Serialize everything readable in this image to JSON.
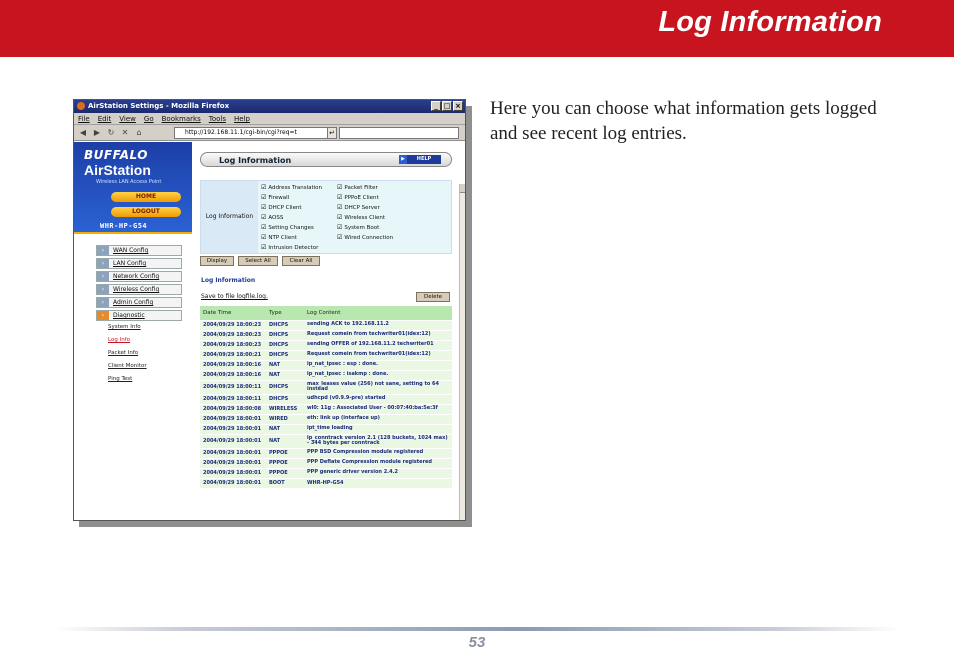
{
  "page": {
    "title": "Log Information",
    "intro": "Here you can choose what information gets logged and see recent log entries.",
    "page_number": "53"
  },
  "browser": {
    "title": "AirStation Settings - Mozilla Firefox",
    "menu": [
      "File",
      "Edit",
      "View",
      "Go",
      "Bookmarks",
      "Tools",
      "Help"
    ],
    "url": "http://192.168.11.1/cgi-bin/cgi?req=t"
  },
  "sidebar": {
    "brand": "BUFFALO",
    "product": "AirStation",
    "product_sub": "Wireless LAN Access Point",
    "home": "HOME",
    "logout": "LOGOUT",
    "model": "WHR-HP-G54",
    "menu": [
      "WAN Config",
      "LAN Config",
      "Network Config",
      "Wireless Config",
      "Admin Config",
      "Diagnostic"
    ],
    "sub": [
      "System Info",
      "Log Info",
      "Packet Info",
      "Client Monitor",
      "Ping Test"
    ]
  },
  "main": {
    "header": "Log Information",
    "help": "HELP",
    "options_label": "Log Information",
    "options": [
      "Address Translation",
      "Packet Filter",
      "Firewall",
      "PPPoE Client",
      "DHCP Client",
      "DHCP Server",
      "AOSS",
      "Wireless Client",
      "Setting Changes",
      "System Boot",
      "NTP Client",
      "Wired Connection",
      "Intrusion Detector"
    ],
    "display": "Display",
    "select_all": "Select All",
    "clear_all": "Clear All",
    "section": "Log Information",
    "save_link": "Save to file logfile.log.",
    "delete": "Delete",
    "columns": [
      "Date Time",
      "Type",
      "Log Content"
    ],
    "rows": [
      [
        "2004/09/29 18:00:23",
        "DHCPS",
        "sending ACK to 192.168.11.2"
      ],
      [
        "2004/09/29 18:00:23",
        "DHCPS",
        "Request comein from techwriter01(idex:12)"
      ],
      [
        "2004/09/29 18:00:23",
        "DHCPS",
        "sending OFFER of 192.168.11.2 techwriter01"
      ],
      [
        "2004/09/29 18:00:21",
        "DHCPS",
        "Request comein from techwriter01(idex:12)"
      ],
      [
        "2004/09/29 18:00:16",
        "NAT",
        "ip_nat_ipsec : esp : done."
      ],
      [
        "2004/09/29 18:00:16",
        "NAT",
        "ip_nat_ipsec : isakmp : done."
      ],
      [
        "2004/09/29 18:00:11",
        "DHCPS",
        "max_leases value (256) not sane, setting to 64 instead"
      ],
      [
        "2004/09/29 18:00:11",
        "DHCPS",
        "udhcpd (v0.9.9-pre) started"
      ],
      [
        "2004/09/29 18:00:08",
        "WIRELESS",
        "wl0: 11g : Associated User - 00:07:40:ba:5e:3f"
      ],
      [
        "2004/09/29 18:00:01",
        "WIRED",
        "eth: link up (interface up)"
      ],
      [
        "2004/09/29 18:00:01",
        "NAT",
        "ipt_time loading"
      ],
      [
        "2004/09/29 18:00:01",
        "NAT",
        "ip_conntrack version 2.1 (128 buckets, 1024 max) - 344 bytes per conntrack"
      ],
      [
        "2004/09/29 18:00:01",
        "PPPOE",
        "PPP BSD Compression module registered"
      ],
      [
        "2004/09/29 18:00:01",
        "PPPOE",
        "PPP Deflate Compression module registered"
      ],
      [
        "2004/09/29 18:00:01",
        "PPPOE",
        "PPP generic driver version 2.4.2"
      ],
      [
        "2004/09/29 18:00:01",
        "BOOT",
        "WHR-HP-G54"
      ]
    ]
  }
}
